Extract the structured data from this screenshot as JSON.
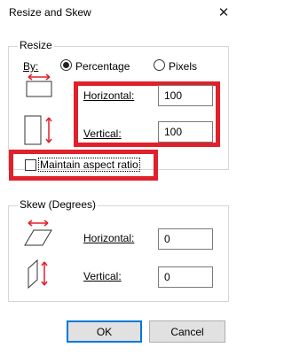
{
  "window": {
    "title": "Resize and Skew",
    "close_glyph": "✕"
  },
  "resize": {
    "group_title": "Resize",
    "by_label": "By:",
    "percentage_label": "Percentage",
    "pixels_label": "Pixels",
    "selected": "percentage",
    "horizontal_label": "Horizontal:",
    "horizontal_value": "100",
    "vertical_label": "Vertical:",
    "vertical_value": "100",
    "maintain_label": "Maintain aspect ratio",
    "maintain_checked": false
  },
  "skew": {
    "group_title": "Skew (Degrees)",
    "horizontal_label": "Horizontal:",
    "horizontal_value": "0",
    "vertical_label": "Vertical:",
    "vertical_value": "0"
  },
  "buttons": {
    "ok_label": "OK",
    "cancel_label": "Cancel"
  },
  "colors": {
    "highlight": "#e0202a",
    "icon_red": "#e0202a",
    "button_focus": "#0078d7"
  }
}
